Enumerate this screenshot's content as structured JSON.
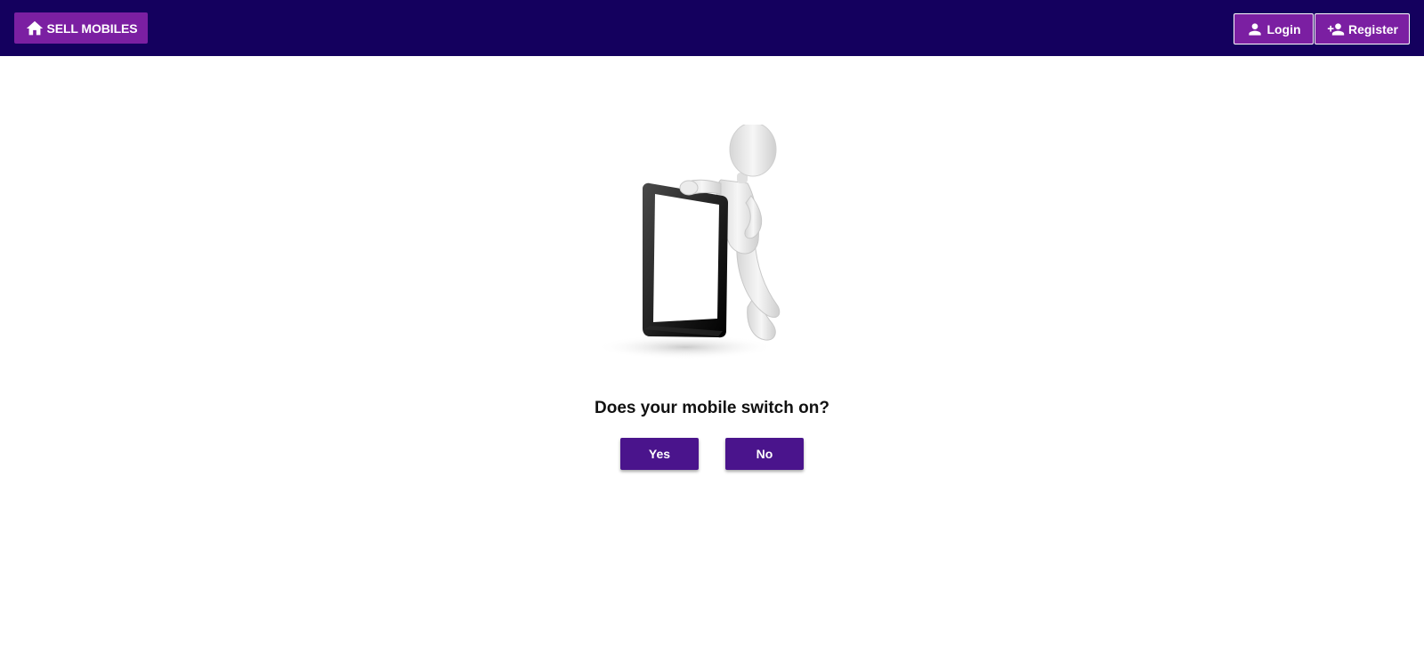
{
  "header": {
    "home_label": "SELL MOBILES",
    "login_label": "Login",
    "register_label": "Register",
    "bg_color": "#14005e",
    "button_color": "#7b1fa2"
  },
  "main": {
    "question": "Does your mobile switch on?",
    "yes_label": "Yes",
    "no_label": "No",
    "button_color": "#4a148c"
  },
  "icons": {
    "home": "home-icon",
    "login": "person-icon",
    "register": "person-add-icon"
  }
}
